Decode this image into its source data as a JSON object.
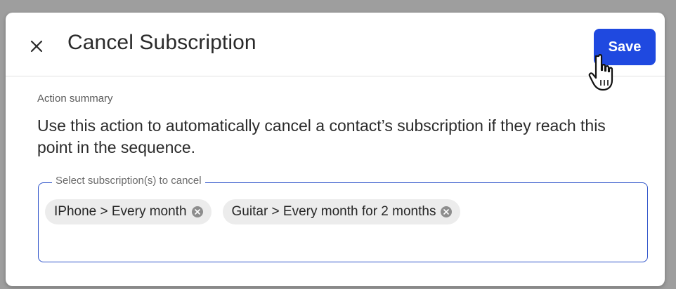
{
  "dialog": {
    "title": "Cancel Subscription",
    "save_label": "Save"
  },
  "summary": {
    "label": "Action summary",
    "text": "Use this action to automatically cancel a contact’s subscription if they reach this point in the sequence."
  },
  "select": {
    "legend": "Select subscription(s) to cancel",
    "chips": [
      {
        "label": "IPhone > Every month"
      },
      {
        "label": "Guitar > Every month for 2 months"
      }
    ]
  },
  "colors": {
    "accent": "#1f49e0",
    "field_border": "#2d52c9",
    "chip_bg": "#ececec"
  },
  "icons": {
    "close": "close-icon",
    "chip_remove": "remove-chip-icon",
    "cursor": "hand-pointer-icon"
  }
}
